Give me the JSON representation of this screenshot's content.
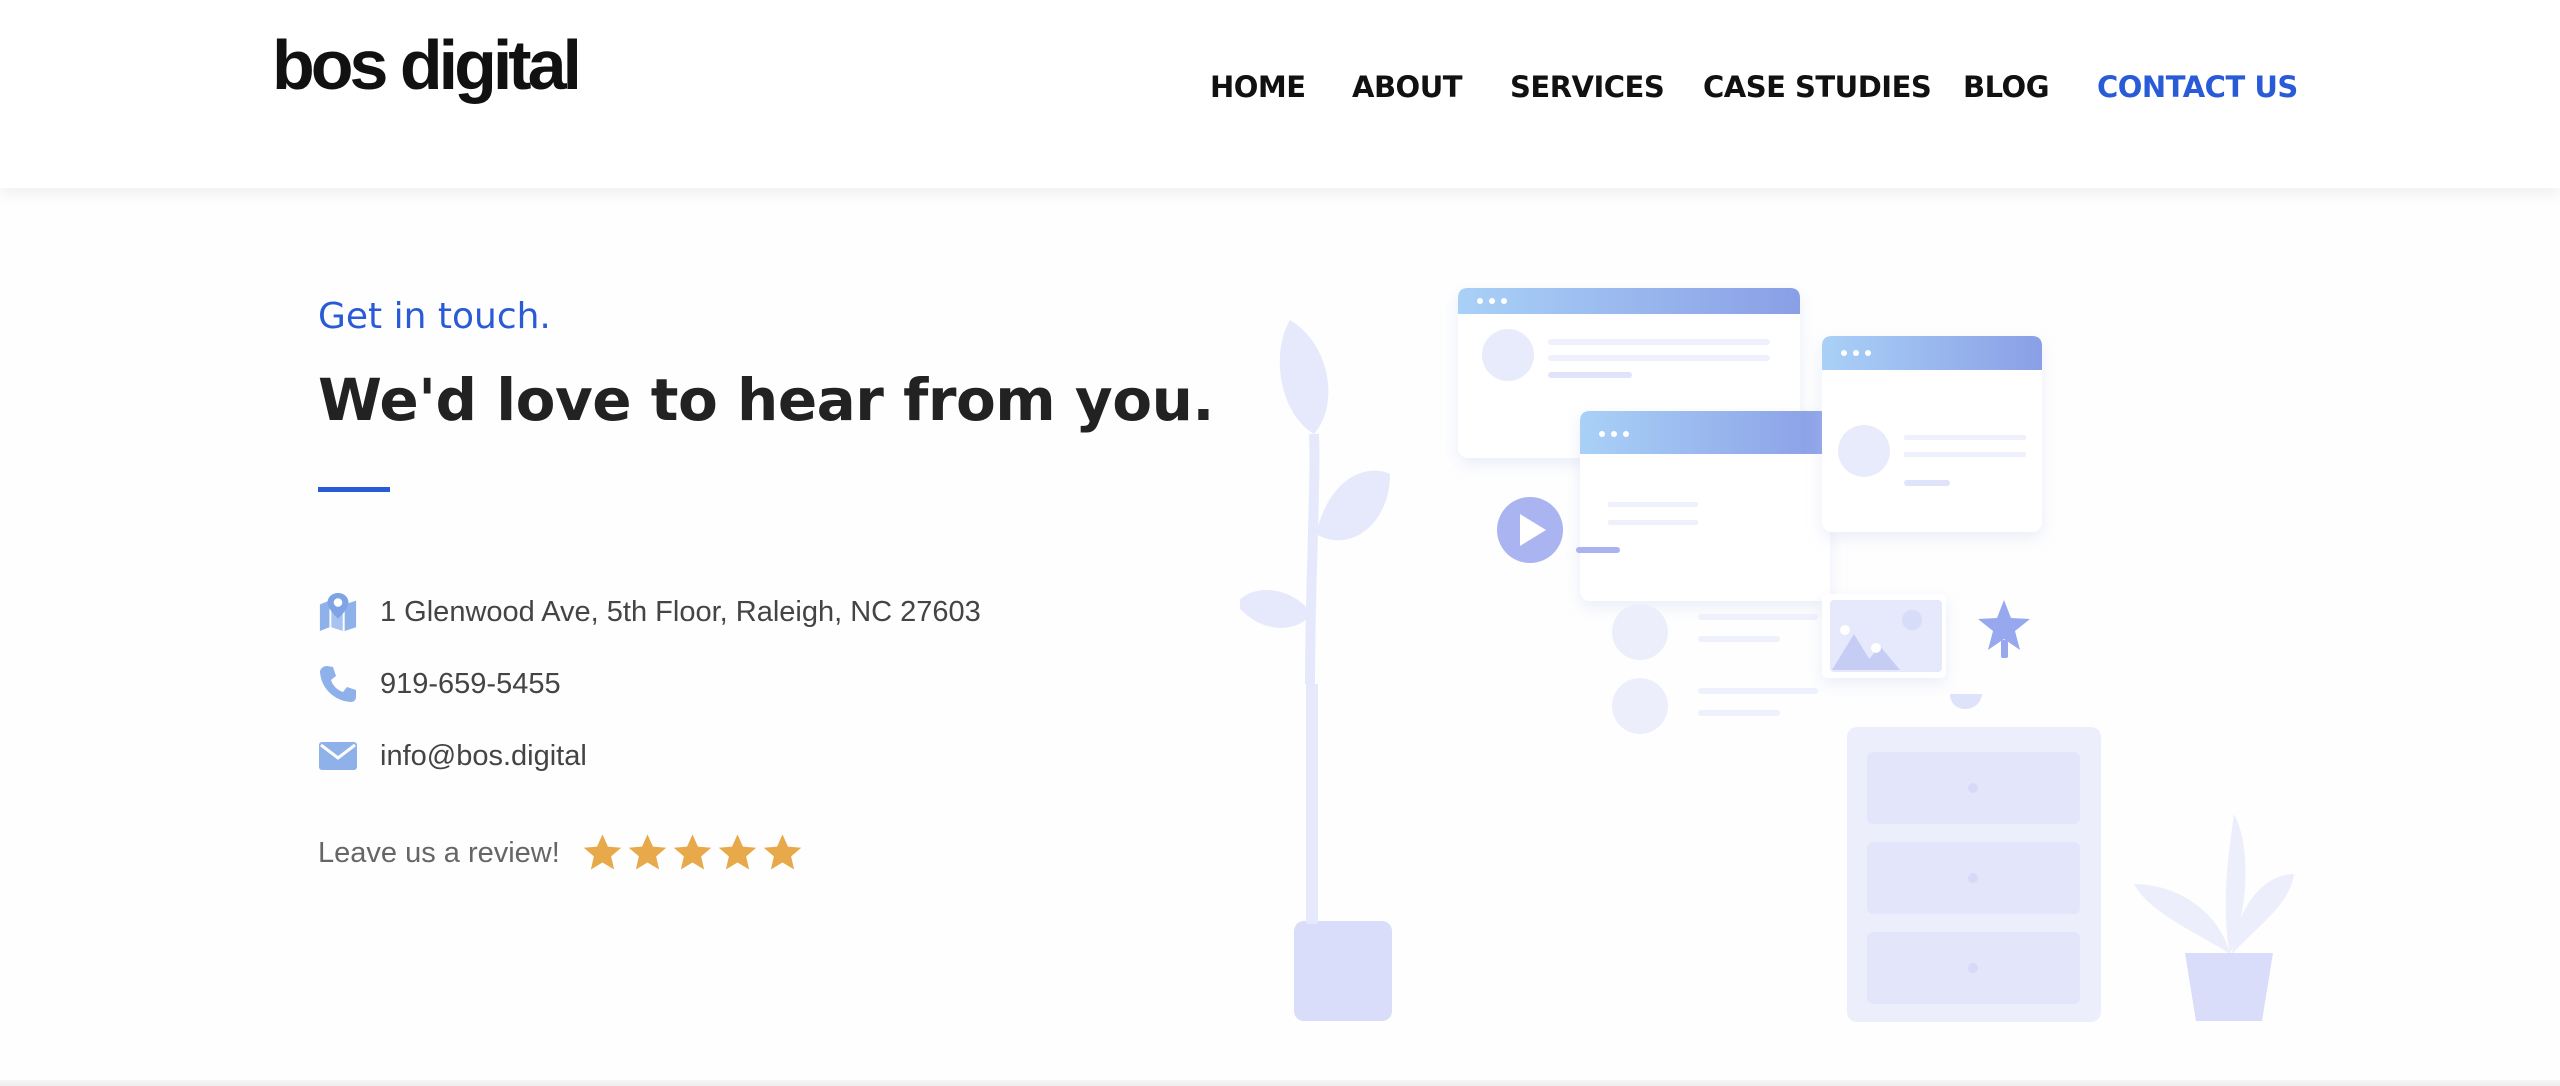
{
  "brand": {
    "logo_text": "bos digital"
  },
  "nav": {
    "items": [
      {
        "label": "HOME"
      },
      {
        "label": "ABOUT"
      },
      {
        "label": "SERVICES"
      },
      {
        "label": "CASE STUDIES"
      },
      {
        "label": "BLOG"
      },
      {
        "label": "CONTACT US"
      }
    ],
    "active_item": "CONTACT US"
  },
  "contact": {
    "eyebrow": "Get in touch.",
    "headline": "We'd love to hear from you.",
    "address": "1 Glenwood Ave, 5th Floor, Raleigh, NC 27603",
    "phone": "919-659-5455",
    "email": "info@bos.digital",
    "review_prompt": "Leave us a review!",
    "review_stars": 5
  },
  "icons": {
    "address": "map-pin-icon",
    "phone": "phone-icon",
    "email": "envelope-icon",
    "star": "star-icon"
  },
  "colors": {
    "accent": "#2a5bd7",
    "icon": "#8fb1ea",
    "star": "#e8a94b",
    "illustration": "#e7eafb"
  }
}
